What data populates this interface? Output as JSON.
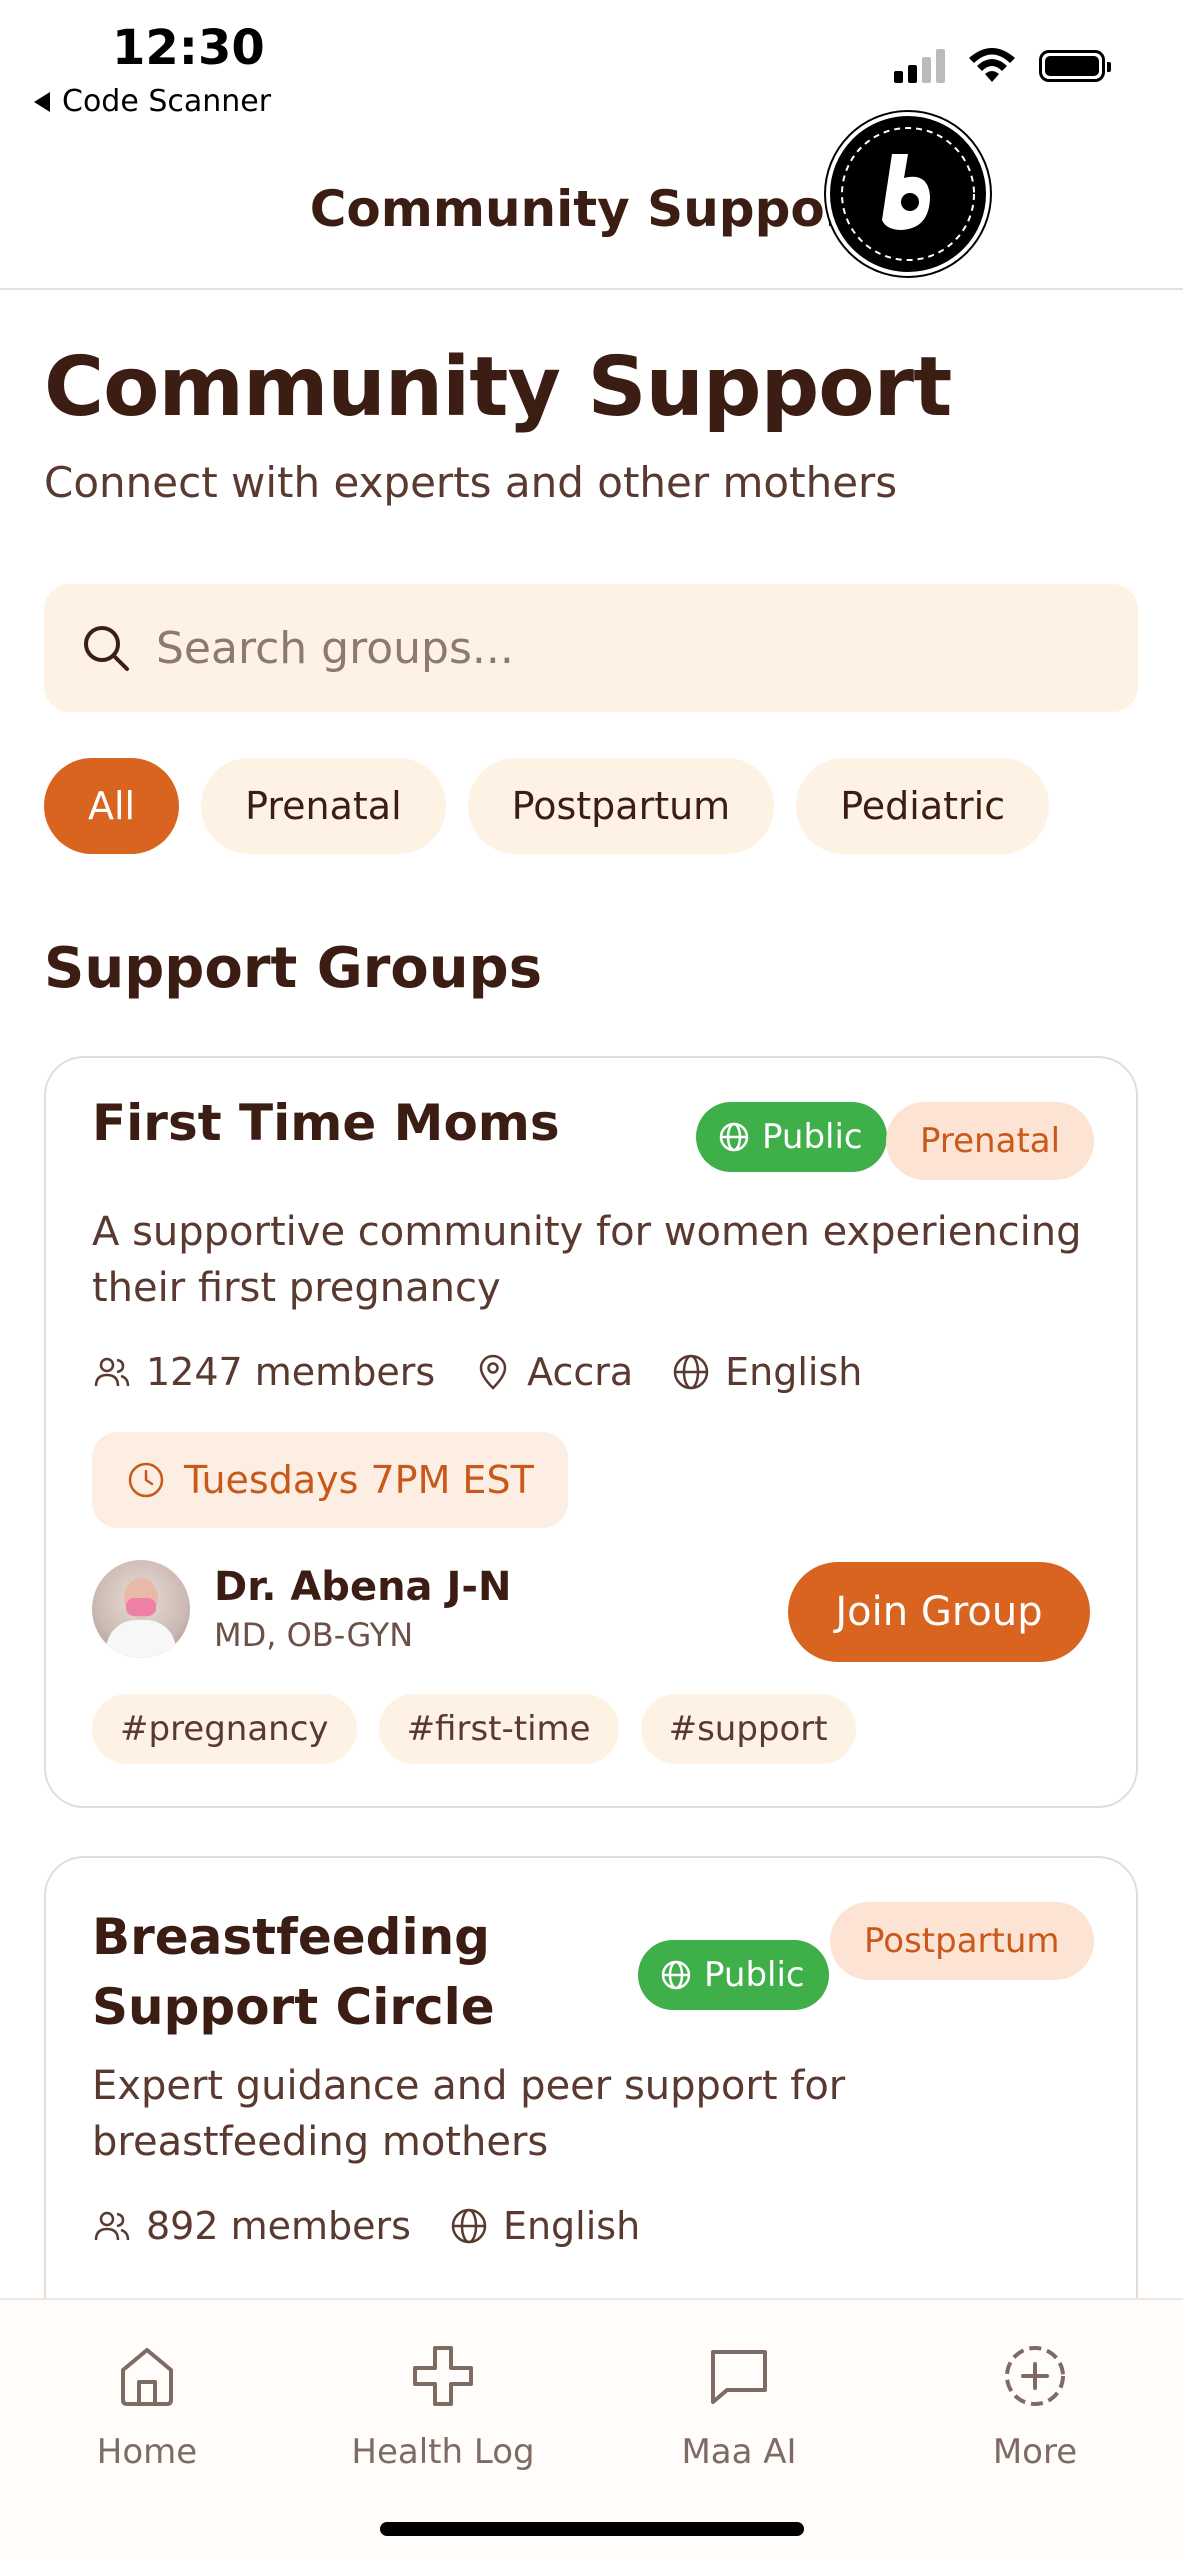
{
  "status_bar": {
    "time": "12:30",
    "back_app": "Code Scanner"
  },
  "header": {
    "title": "Community Support"
  },
  "page": {
    "title": "Community Support",
    "subtitle": "Connect with experts and other mothers"
  },
  "search": {
    "placeholder": "Search groups..."
  },
  "filters": [
    "All",
    "Prenatal",
    "Postpartum",
    "Pediatric"
  ],
  "section_title": "Support Groups",
  "groups": [
    {
      "title": "First Time Moms",
      "visibility": "Public",
      "category": "Prenatal",
      "description": "A supportive community for women experiencing their first pregnancy",
      "members": "1247 members",
      "location": "Accra",
      "language": "English",
      "schedule": "Tuesdays 7PM EST",
      "host_name": "Dr. Abena J-N",
      "host_credentials": "MD, OB-GYN",
      "join_label": "Join Group",
      "tags": [
        "#pregnancy",
        "#first-time",
        "#support"
      ]
    },
    {
      "title_line1": "Breastfeeding",
      "title_line2": "Support Circle",
      "visibility": "Public",
      "category": "Postpartum",
      "description": "Expert guidance and peer support for breastfeeding mothers",
      "members": "892 members",
      "language": "English"
    }
  ],
  "bottom_nav": [
    {
      "label": "Home",
      "icon": "home-icon"
    },
    {
      "label": "Health Log",
      "icon": "plus-cross-icon"
    },
    {
      "label": "Maa AI",
      "icon": "chat-icon"
    },
    {
      "label": "More",
      "icon": "dashed-plus-circle-icon"
    }
  ],
  "colors": {
    "accent": "#d9641f",
    "public_green": "#3faf4a",
    "chip_bg": "#fdf2e3",
    "text_dark": "#3b1d14"
  }
}
